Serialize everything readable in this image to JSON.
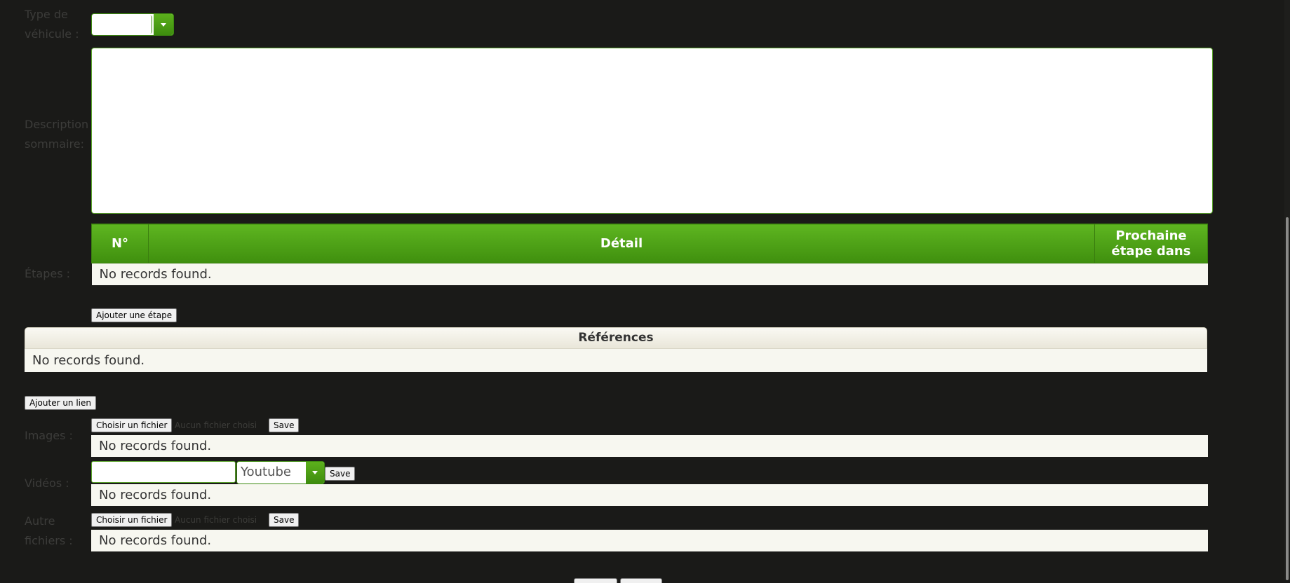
{
  "vehicle": {
    "label": "Type de véhicule :",
    "value": ""
  },
  "description": {
    "label": "Description sommaire:",
    "value": ""
  },
  "etapes": {
    "label": "Étapes :",
    "columns": [
      "N°",
      "Détail",
      "Prochaine étape dans"
    ],
    "empty": "No records found.",
    "add_button": "Ajouter une étape"
  },
  "references": {
    "header": "Références",
    "empty": "No records found.",
    "add_button": "Ajouter un lien"
  },
  "images": {
    "label": "Images :",
    "choose_button": "Choisir un fichier",
    "no_file": "Aucun fichier choisi",
    "save_button": "Save",
    "empty": "No records found."
  },
  "videos": {
    "label": "Vidéos :",
    "url_value": "",
    "source_selected": "Youtube",
    "save_button": "Save",
    "empty": "No records found."
  },
  "autres": {
    "label": "Autre fichiers :",
    "choose_button": "Choisir un fichier",
    "no_file": "Aucun fichier choisi",
    "save_button": "Save",
    "empty": "No records found."
  },
  "colors": {
    "accent_green": "#4a9d14",
    "background": "#1a1a18",
    "row_background": "#f7f7f0"
  }
}
